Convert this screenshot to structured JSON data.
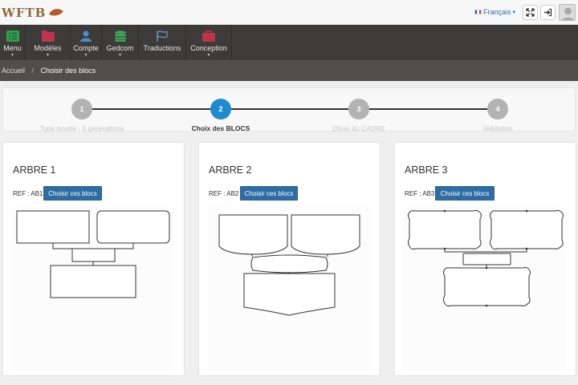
{
  "header": {
    "logo_text": "WFTB",
    "language": "Français",
    "flag_colors": [
      "#1f4fa3",
      "#ffffff",
      "#d0312d"
    ],
    "icons": [
      "expand-icon",
      "logout-icon",
      "user-avatar-icon"
    ]
  },
  "nav": {
    "items": [
      {
        "label": "Menu",
        "icon": "list-icon",
        "color": "#2e9e4f",
        "caret": "▾"
      },
      {
        "label": "Modèles",
        "icon": "folder-icon",
        "color": "#c0334b",
        "caret": "▾"
      },
      {
        "label": "Compte",
        "icon": "user-icon",
        "color": "#4a8fd0",
        "caret": "▾"
      },
      {
        "label": "Gedcom",
        "icon": "database-icon",
        "color": "#3ea35a",
        "caret": "▾"
      },
      {
        "label": "Traductions",
        "icon": "flag-icon",
        "color": "#6a8db5",
        "caret": ""
      },
      {
        "label": "Conception",
        "icon": "briefcase-icon",
        "color": "#c0334b",
        "caret": "▾"
      }
    ]
  },
  "breadcrumb": {
    "home": "Accueil",
    "separator": "/",
    "current": "Choisir des blocs"
  },
  "wizard": {
    "steps": [
      {
        "number": "1",
        "label": "Type bowtie - 5 générations",
        "state": "done"
      },
      {
        "number": "2",
        "label": "Choix des BLOCS",
        "state": "active"
      },
      {
        "number": "3",
        "label": "Choix du CADRE",
        "state": "pending"
      },
      {
        "number": "4",
        "label": "Validation",
        "state": "pending"
      }
    ],
    "active_color": "#1e8bd0",
    "inactive_color": "#b3b3b3"
  },
  "cards": [
    {
      "title": "ARBRE 1",
      "ref": "REF : AB1",
      "button": "Choisir ces blocs",
      "style": "plain"
    },
    {
      "title": "ARBRE 2",
      "ref": "REF : AB2",
      "button": "Choisir ces blocs",
      "style": "curved"
    },
    {
      "title": "ARBRE 3",
      "ref": "REF : AB3",
      "button": "Choisir ces blocs",
      "style": "ornate"
    }
  ]
}
